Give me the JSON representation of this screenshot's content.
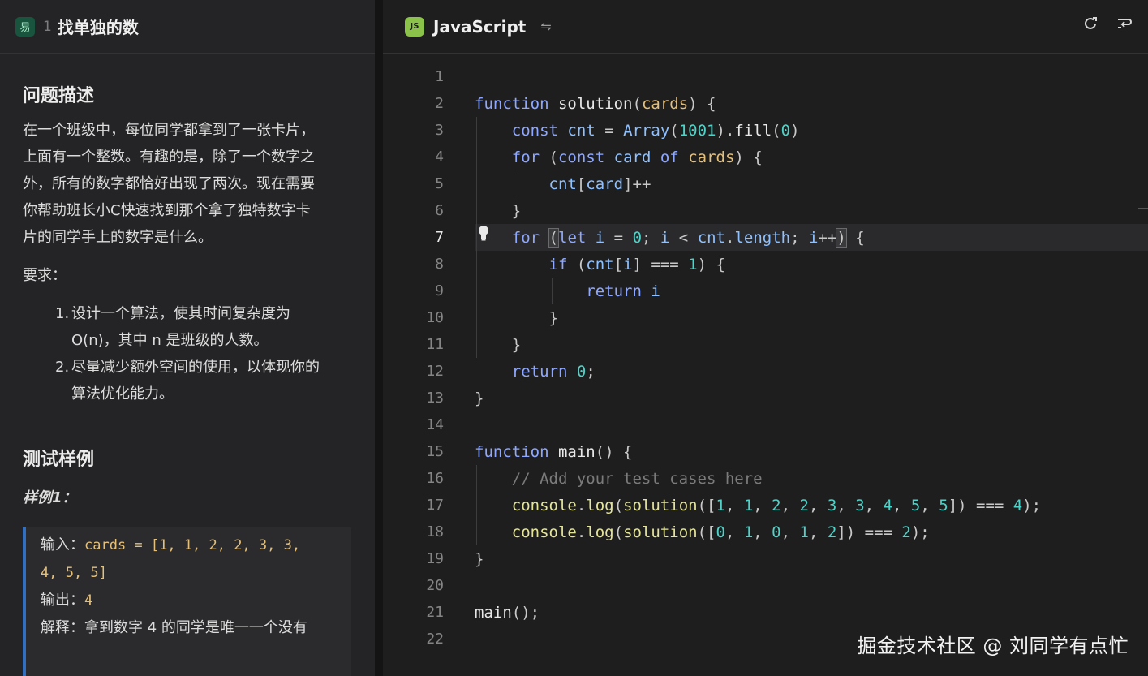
{
  "problem": {
    "badge": "易",
    "number": "1",
    "title": "找单独的数"
  },
  "description": {
    "heading": "问题描述",
    "lines": [
      "在一个班级中，每位同学都拿到了一张卡片，",
      "上面有一个整数。有趣的是，除了一个数字之",
      "外，所有的数字都恰好出现了两次。现在需要",
      "你帮助班长小C快速找到那个拿了独特数字卡",
      "片的同学手上的数字是什么。"
    ],
    "requirements_label": "要求：",
    "requirements": [
      {
        "num": "1.",
        "lines": [
          "设计一个算法，使其时间复杂度为",
          "O(n)，其中 n 是班级的人数。"
        ]
      },
      {
        "num": "2.",
        "lines": [
          "尽量减少额外空间的使用，以体现你的",
          "算法优化能力。"
        ]
      }
    ]
  },
  "tests": {
    "heading": "测试样例",
    "sample_label": "样例1：",
    "input_label": "输入：",
    "input_code_line1": "cards = [1, 1, 2, 2, 3, 3,",
    "input_code_line2": "4, 5, 5]",
    "output_label": "输出：",
    "output_value": "4",
    "explain_label": "解释：",
    "explain_text": "拿到数字 4 的同学是唯一一个没有"
  },
  "editor": {
    "language": "JavaScript",
    "js_badge": "JS",
    "swap_icon": "swap-icon",
    "refresh_icon": "refresh-icon",
    "wrap_icon": "wrap-icon",
    "active_line": 7,
    "line_numbers": [
      "1",
      "2",
      "3",
      "4",
      "5",
      "6",
      "7",
      "8",
      "9",
      "10",
      "11",
      "12",
      "13",
      "14",
      "15",
      "16",
      "17",
      "18",
      "19",
      "20",
      "21",
      "22"
    ]
  },
  "watermark": "掘金技术社区 @ 刘同学有点忙"
}
